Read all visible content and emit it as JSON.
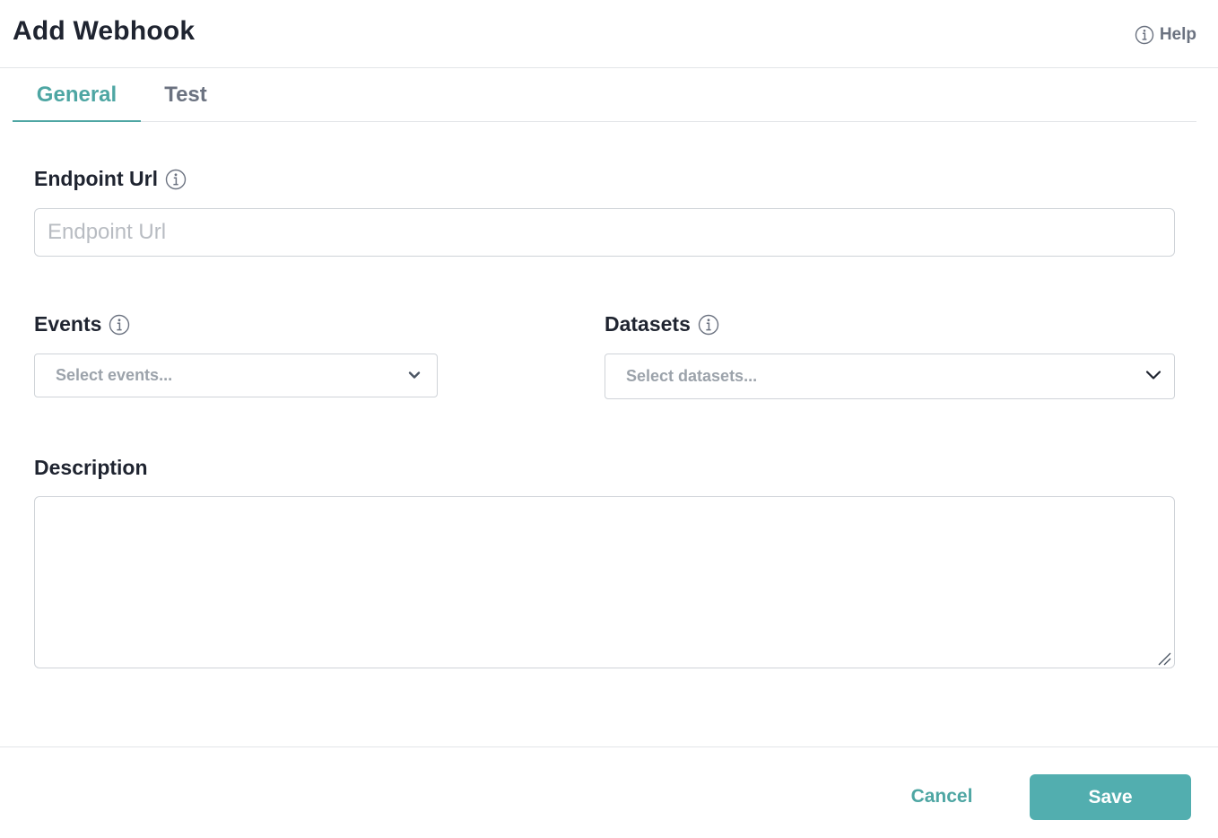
{
  "dialog": {
    "title": "Add Webhook",
    "help_label": "Help"
  },
  "tabs": [
    {
      "label": "General",
      "active": true
    },
    {
      "label": "Test",
      "active": false
    }
  ],
  "form": {
    "endpoint": {
      "label": "Endpoint Url",
      "value": "",
      "placeholder": "Endpoint Url"
    },
    "events": {
      "label": "Events",
      "placeholder": "Select events..."
    },
    "datasets": {
      "label": "Datasets",
      "placeholder": "Select datasets..."
    },
    "description": {
      "label": "Description",
      "value": ""
    }
  },
  "footer": {
    "cancel_label": "Cancel",
    "save_label": "Save"
  },
  "colors": {
    "accent": "#4ea6a3",
    "primary_button": "#52aeaf",
    "text": "#1f2430",
    "muted": "#6b7280",
    "border": "#cfd3d8"
  },
  "icons": {
    "help": "info-circle-icon",
    "field_info": "info-circle-icon",
    "dropdown": "chevron-down-icon",
    "resize": "resize-grip-icon"
  }
}
